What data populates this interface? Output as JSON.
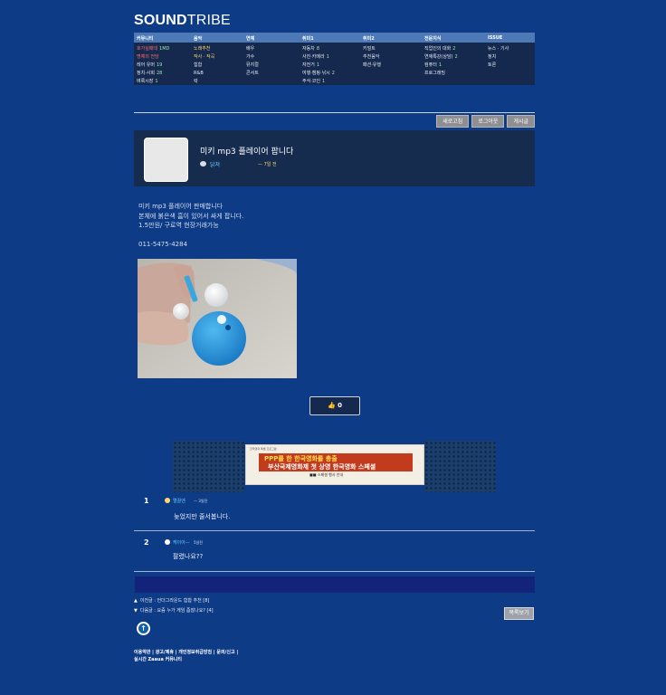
{
  "site": {
    "logo_bold": "SOUND",
    "logo_thin": "TRIBE"
  },
  "nav": {
    "headers": [
      "커뮤니티",
      "음악",
      "연예",
      "취미1",
      "취미2",
      "전문지식",
      "ISSUE"
    ],
    "columns": [
      [
        {
          "label": "호가실패데",
          "count": "1MD",
          "style": "red"
        },
        {
          "label": "명예의 전당",
          "count": "",
          "style": "red"
        },
        {
          "label": "레어 유머",
          "count": "19",
          "style": ""
        },
        {
          "label": "정치·사회",
          "count": "28",
          "style": ""
        },
        {
          "label": "벼룩시장",
          "count": "1",
          "style": ""
        }
      ],
      [
        {
          "label": "노래추천",
          "count": "",
          "style": "hl"
        },
        {
          "label": "작사 · 작곡",
          "count": "",
          "style": "hl"
        },
        {
          "label": "힙합",
          "count": "",
          "style": ""
        },
        {
          "label": "R&B",
          "count": "",
          "style": ""
        },
        {
          "label": "락",
          "count": "",
          "style": ""
        }
      ],
      [
        {
          "label": "배우",
          "count": "",
          "style": ""
        },
        {
          "label": "가수",
          "count": "",
          "style": ""
        },
        {
          "label": "뮤지컬",
          "count": "",
          "style": ""
        },
        {
          "label": "콘서트",
          "count": "",
          "style": ""
        }
      ],
      [
        {
          "label": "자동차",
          "count": "8",
          "style": ""
        },
        {
          "label": "사진·카메라",
          "count": "1",
          "style": ""
        },
        {
          "label": "자전거",
          "count": "1",
          "style": ""
        },
        {
          "label": "여행·캠핑·낚시",
          "count": "2",
          "style": ""
        },
        {
          "label": "주식·코인",
          "count": "1",
          "style": ""
        }
      ],
      [
        {
          "label": "키덜트",
          "count": "",
          "style": ""
        },
        {
          "label": "추천음악",
          "count": "",
          "style": ""
        },
        {
          "label": "패션·유행",
          "count": "",
          "style": ""
        }
      ],
      [
        {
          "label": "직업인의 대화",
          "count": "2",
          "style": ""
        },
        {
          "label": "연애특강(상담)",
          "count": "2",
          "style": ""
        },
        {
          "label": "컴퓨터",
          "count": "1",
          "style": ""
        },
        {
          "label": "프로그래밍",
          "count": "",
          "style": ""
        }
      ],
      [
        {
          "label": "뉴스 · 기사",
          "count": "",
          "style": ""
        },
        {
          "label": "정치",
          "count": "",
          "style": ""
        },
        {
          "label": "토론",
          "count": "",
          "style": ""
        }
      ]
    ]
  },
  "top_buttons": [
    "새로고침",
    "로그아웃",
    "게시글"
  ],
  "post": {
    "title": "미키 mp3 플레이어 팝니다",
    "author": "닭쳐",
    "date": "— 7일 전",
    "body_lines": [
      "미키 mp3 플레이어 판매합니다",
      "본체에 붉은색 흠이 있어서 싸게 팝니다.",
      "1.5만원/ 구로역 현장거래가능"
    ],
    "phone": "011-5475-4284",
    "likes": "0"
  },
  "ad": {
    "line1": "PPP를 한 한국영화를 총출",
    "line2": "부산국제영화제 첫 상영 한국영화 스페셜",
    "line3": "■■ 스페셜 행사 안내",
    "line4": "한국영화 특별 프로그램"
  },
  "comments": [
    {
      "num": "1",
      "name": "엘끌엔",
      "time": "— 3일전",
      "text": "늦었지만 줄서봅니다."
    },
    {
      "num": "2",
      "name": "케이아—",
      "time": "5일전",
      "text": "팔렸나요??"
    }
  ],
  "prev": {
    "arrow": "▲",
    "text": "이전글 : 언더그라운드 힙합 추천  [8]"
  },
  "next": {
    "arrow": "▼",
    "text": "다음글 : 요즘 누가 게임 좀잖나요? [4]"
  },
  "list_button": "목록보기",
  "up_icon": "↑",
  "footer": {
    "line1": "이용약관 | 광고/제휴 | 개인정보취급방침 | 문의/신고 |",
    "line2": "실시간 Zaaua 커뮤니티"
  }
}
